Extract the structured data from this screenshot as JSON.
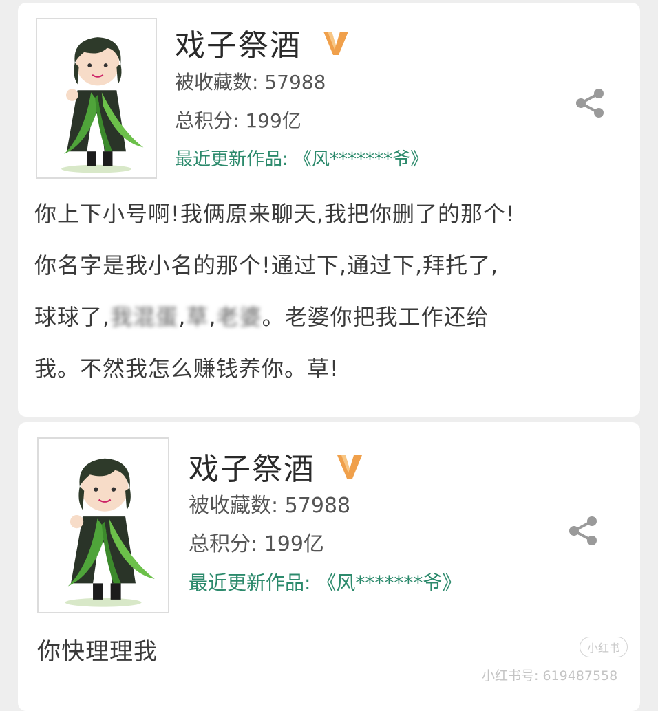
{
  "posts": [
    {
      "author_name": "戏子祭酒",
      "favorites_label": "被收藏数:",
      "favorites_value": "57988",
      "score_label": "总积分:",
      "score_value": "199亿",
      "recent_label": "最近更新作品:",
      "recent_work": "《风*******爷》",
      "body_lines": [
        "你上下小号啊!我俩原来聊天,我把你删了的那个!",
        "你名字是我小名的那个!通过下,通过下,拜托了,",
        "球球了,",
        "。老婆你把我工作还给",
        "我。不然我怎么赚钱养你。草!"
      ],
      "blurred_segments": [
        "我混蛋",
        "草",
        "老婆"
      ]
    },
    {
      "author_name": "戏子祭酒",
      "favorites_label": "被收藏数:",
      "favorites_value": "57988",
      "score_label": "总积分:",
      "score_value": "199亿",
      "recent_label": "最近更新作品:",
      "recent_work": "《风*******爷》",
      "body_lines": [
        "你快理理我"
      ]
    }
  ],
  "watermark": {
    "badge": "小红书",
    "id_text": "小红书号: 619487558"
  },
  "icons": [
    "avatar",
    "vip-badge-icon",
    "share-icon"
  ],
  "colors": {
    "recent_work_green": "#2c8a6c",
    "vip_orange": "#f0a04b",
    "background": "#eeeeee"
  }
}
